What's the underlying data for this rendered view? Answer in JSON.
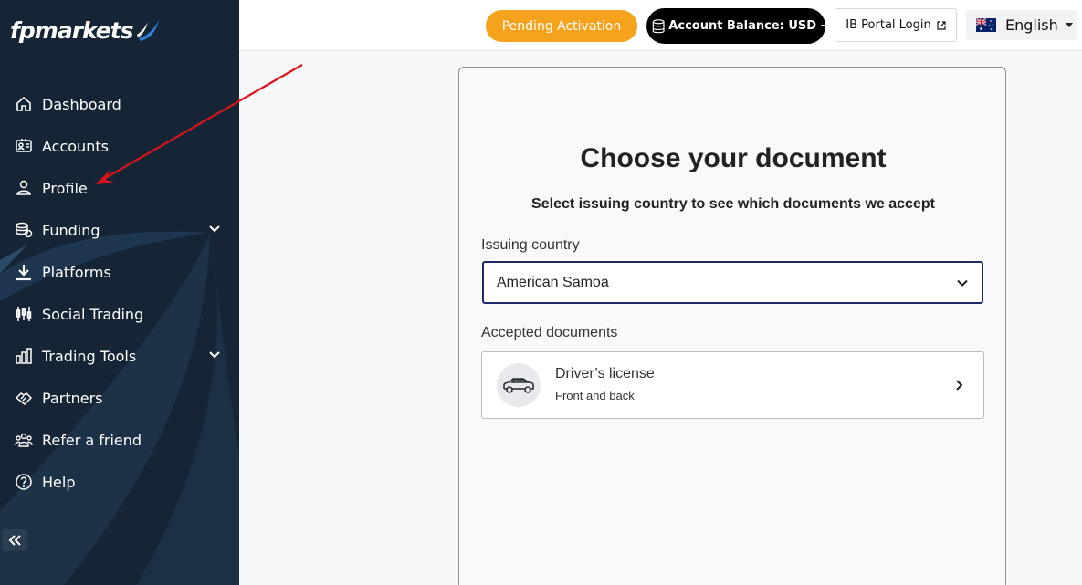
{
  "brand": {
    "logo_text": "fpmarkets",
    "logo_label": "fpmarkets"
  },
  "sidebar": {
    "items": [
      {
        "label": "Dashboard",
        "icon": "home-icon",
        "has_submenu": false
      },
      {
        "label": "Accounts",
        "icon": "id-card-icon",
        "has_submenu": false
      },
      {
        "label": "Profile",
        "icon": "users-icon",
        "has_submenu": false
      },
      {
        "label": "Funding",
        "icon": "coins-icon",
        "has_submenu": true
      },
      {
        "label": "Platforms",
        "icon": "download-icon",
        "has_submenu": false
      },
      {
        "label": "Social Trading",
        "icon": "candlestick-icon",
        "has_submenu": false
      },
      {
        "label": "Trading Tools",
        "icon": "bar-chart-icon",
        "has_submenu": true
      },
      {
        "label": "Partners",
        "icon": "handshake-icon",
        "has_submenu": false
      },
      {
        "label": "Refer a friend",
        "icon": "group-icon",
        "has_submenu": false
      },
      {
        "label": "Help",
        "icon": "question-icon",
        "has_submenu": false
      }
    ],
    "collapse_icon": "double-chevron-left-icon"
  },
  "header": {
    "pending_label": "Pending Activation",
    "balance_label": "Account Balance: USD -",
    "ib_portal_label": "IB Portal Login",
    "language_label": "English",
    "language_flag": "australia-flag-icon"
  },
  "document": {
    "title": "Choose your document",
    "subtitle": "Select issuing country to see which documents we accept",
    "country_label": "Issuing country",
    "country_value": "American Samoa",
    "accepted_label": "Accepted documents",
    "options": [
      {
        "title": "Driver’s license",
        "description": "Front and back",
        "icon": "car-icon"
      }
    ]
  },
  "colors": {
    "sidebar_bg": "#152536",
    "pending_bg": "#f5a21d",
    "balance_bg": "#000000",
    "select_border": "#1f2a6b",
    "annotation_arrow": "#d9141b"
  }
}
